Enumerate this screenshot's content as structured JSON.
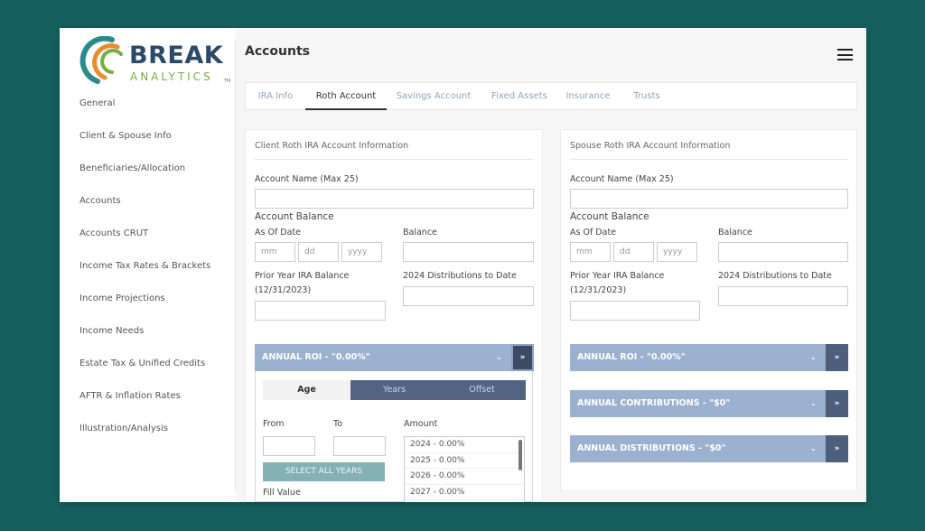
{
  "brand": {
    "line1": "BREAK",
    "line2": "ANALYTICS",
    "tm": "TM",
    "colors": {
      "navy": "#2b4a6a",
      "green": "#78ad45",
      "orange": "#e98c2c",
      "teal": "#2b8b8c"
    }
  },
  "sidebar": {
    "items": [
      {
        "label": "General"
      },
      {
        "label": "Client & Spouse Info"
      },
      {
        "label": "Beneficiaries/Allocation"
      },
      {
        "label": "Accounts"
      },
      {
        "label": "Accounts CRUT"
      },
      {
        "label": "Income Tax Rates & Brackets"
      },
      {
        "label": "Income Projections"
      },
      {
        "label": "Income Needs"
      },
      {
        "label": "Estate Tax & Unified Credits"
      },
      {
        "label": "AFTR & Inflation Rates"
      },
      {
        "label": "Illustration/Analysis"
      }
    ]
  },
  "header": {
    "title": "Accounts",
    "menu_icon": "hamburger-icon"
  },
  "tabs": [
    {
      "label": "IRA Info"
    },
    {
      "label": "Roth Account",
      "active": true
    },
    {
      "label": "Savings Account"
    },
    {
      "label": "Fixed Assets"
    },
    {
      "label": "Insurance"
    },
    {
      "label": "Trusts"
    }
  ],
  "left_panel": {
    "title": "Client Roth IRA Account Information",
    "account_name_label": "Account Name (Max 25)",
    "account_name_value": "",
    "account_balance_label": "Account Balance",
    "as_of_date_label": "As Of Date",
    "date_placeholders": {
      "mm": "mm",
      "dd": "dd",
      "yyyy": "yyyy"
    },
    "balance_label": "Balance",
    "prior_year_label_1": "Prior Year IRA Balance",
    "prior_year_label_2": "(12/31/2023)",
    "distributions_label": "2024 Distributions to Date",
    "roi_accordion": {
      "title": "ANNUAL ROI - \"0.00%\"",
      "segments": [
        {
          "label": "Age",
          "active": true
        },
        {
          "label": "Years"
        },
        {
          "label": "Offset"
        }
      ],
      "from_label": "From",
      "to_label": "To",
      "amount_label": "Amount",
      "select_all_label": "SELECT ALL YEARS",
      "fill_value_label": "Fill Value",
      "amounts": [
        "2024 - 0.00%",
        "2025 - 0.00%",
        "2026 - 0.00%",
        "2027 - 0.00%"
      ]
    }
  },
  "right_panel": {
    "title": "Spouse Roth IRA Account Information",
    "account_name_label": "Account Name (Max 25)",
    "account_name_value": "",
    "account_balance_label": "Account Balance",
    "as_of_date_label": "As Of Date",
    "date_placeholders": {
      "mm": "mm",
      "dd": "dd",
      "yyyy": "yyyy"
    },
    "balance_label": "Balance",
    "prior_year_label_1": "Prior Year IRA Balance",
    "prior_year_label_2": "(12/31/2023)",
    "distributions_label": "2024 Distributions to Date",
    "accordions": [
      {
        "title": "ANNUAL ROI - \"0.00%\""
      },
      {
        "title": "ANNUAL CONTRIBUTIONS - \"$0\""
      },
      {
        "title": "ANNUAL DISTRIBUTIONS - \"$0\""
      }
    ]
  },
  "icons": {
    "chevron": "⌄",
    "expand": "»"
  },
  "colors": {
    "background": "#15605e",
    "accordion": "#9bb1cf",
    "accordion_button": "#4e5f7c",
    "fill_button": "#84b2b4"
  }
}
